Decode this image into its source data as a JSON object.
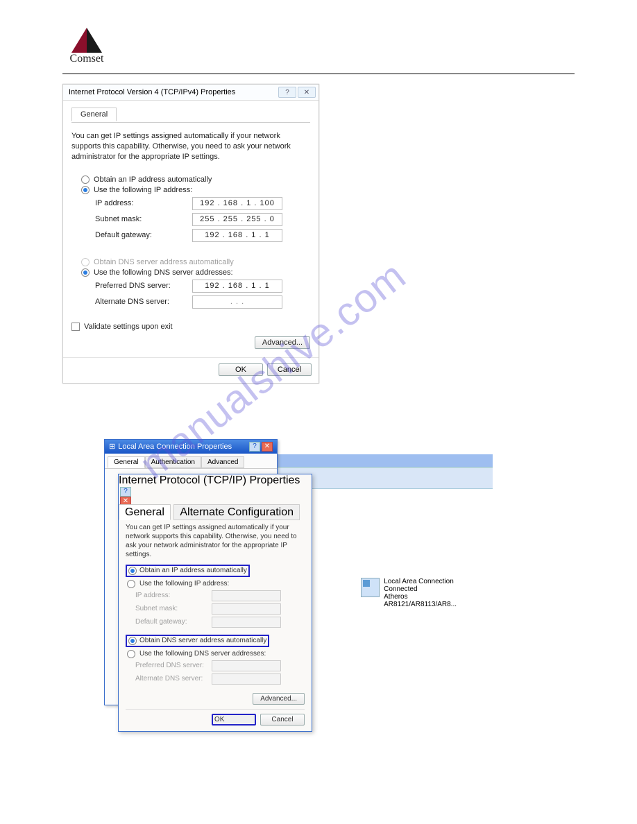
{
  "brand": {
    "name": "Comset"
  },
  "dialog1": {
    "title": "Internet Protocol Version 4 (TCP/IPv4) Properties",
    "tab": "General",
    "intro": "You can get IP settings assigned automatically if your network supports this capability. Otherwise, you need to ask your network administrator for the appropriate IP settings.",
    "radios": {
      "auto_ip": "Obtain an IP address automatically",
      "manual_ip": "Use the following IP address:",
      "auto_dns": "Obtain DNS server address automatically",
      "manual_dns": "Use the following DNS server addresses:"
    },
    "fields": {
      "ip_label": "IP address:",
      "ip_value": "192 . 168 .   1   . 100",
      "mask_label": "Subnet mask:",
      "mask_value": "255 . 255 . 255 .   0",
      "gw_label": "Default gateway:",
      "gw_value": "192 . 168 .   1   .   1",
      "pdns_label": "Preferred DNS server:",
      "pdns_value": "192 . 168 .   1   .   1",
      "adns_label": "Alternate DNS server:",
      "adns_value": ".         .         ."
    },
    "validate": "Validate settings upon exit",
    "advanced": "Advanced...",
    "ok": "OK",
    "cancel": "Cancel"
  },
  "dialog2": {
    "lac_title": "Local Area Connection Properties",
    "lac_tabs": {
      "general": "General",
      "auth": "Authentication",
      "adv": "Advanced"
    },
    "tcp_title": "Internet Protocol (TCP/IP) Properties",
    "tcp_tabs": {
      "general": "General",
      "alt": "Alternate Configuration"
    },
    "intro": "You can get IP settings assigned automatically if your network supports this capability. Otherwise, you need to ask your network administrator for the appropriate IP settings.",
    "radios": {
      "auto_ip": "Obtain an IP address automatically",
      "manual_ip": "Use the following IP address:",
      "auto_dns": "Obtain DNS server address automatically",
      "manual_dns": "Use the following DNS server addresses:"
    },
    "fields": {
      "ip_label": "IP address:",
      "mask_label": "Subnet mask:",
      "gw_label": "Default gateway:",
      "pdns_label": "Preferred DNS server:",
      "adns_label": "Alternate DNS server:"
    },
    "advanced": "Advanced...",
    "ok": "OK",
    "cancel": "Cancel",
    "net": {
      "line1": "Local Area Connection",
      "line2": "Connected",
      "line3": "Atheros AR8121/AR8113/AR8..."
    }
  },
  "watermark": "manualshive.com"
}
